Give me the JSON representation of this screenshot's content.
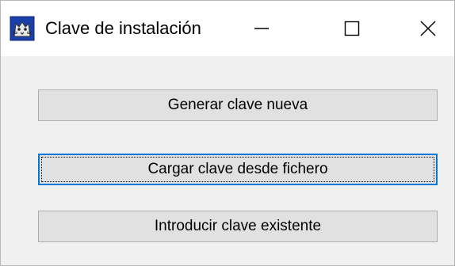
{
  "window": {
    "title": "Clave de instalación",
    "icon": "cat-app-icon",
    "controls": {
      "minimize": "minimize-icon",
      "maximize": "maximize-icon",
      "close": "close-icon"
    }
  },
  "buttons": {
    "generate_label": "Generar clave nueva",
    "load_label": "Cargar clave desde fichero",
    "enter_label": "Introducir clave existente"
  },
  "colors": {
    "focus_border": "#0078d7",
    "button_face": "#e1e1e1",
    "window_bg": "#f0f0f0"
  }
}
